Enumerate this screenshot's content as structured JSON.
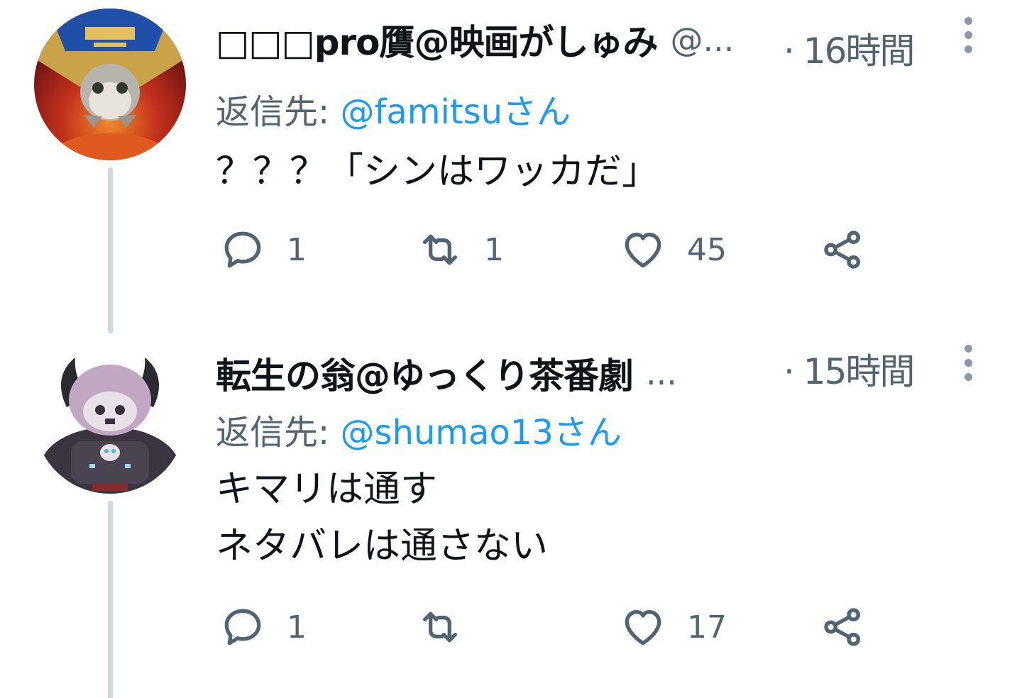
{
  "tweets": [
    {
      "display_name": "□□□pro贋@映画がしゅみ",
      "handle": "@...",
      "time": "· 16時間",
      "reply_label": "返信先: ",
      "reply_mention": "@famitsuさん",
      "body_lines": [
        "？？？「シンはワッカだ」"
      ],
      "reply_count": "1",
      "retweet_count": "1",
      "like_count": "45"
    },
    {
      "display_name": "転生の翁@ゆっくり茶番劇",
      "handle": "...",
      "time": "· 15時間",
      "reply_label": "返信先: ",
      "reply_mention": "@shumao13さん",
      "body_lines": [
        "キマリは通す",
        "ネタバレは通さない"
      ],
      "reply_count": "1",
      "retweet_count": "",
      "like_count": "17"
    }
  ],
  "icons": {
    "reply": "comment-icon",
    "retweet": "retweet-icon",
    "like": "heart-icon",
    "share": "share-icon",
    "more": "more-vertical-icon"
  },
  "colors": {
    "text_primary": "#0f1419",
    "text_secondary": "#536471",
    "link": "#1d9bf0",
    "thread_line": "#cfd9de"
  }
}
